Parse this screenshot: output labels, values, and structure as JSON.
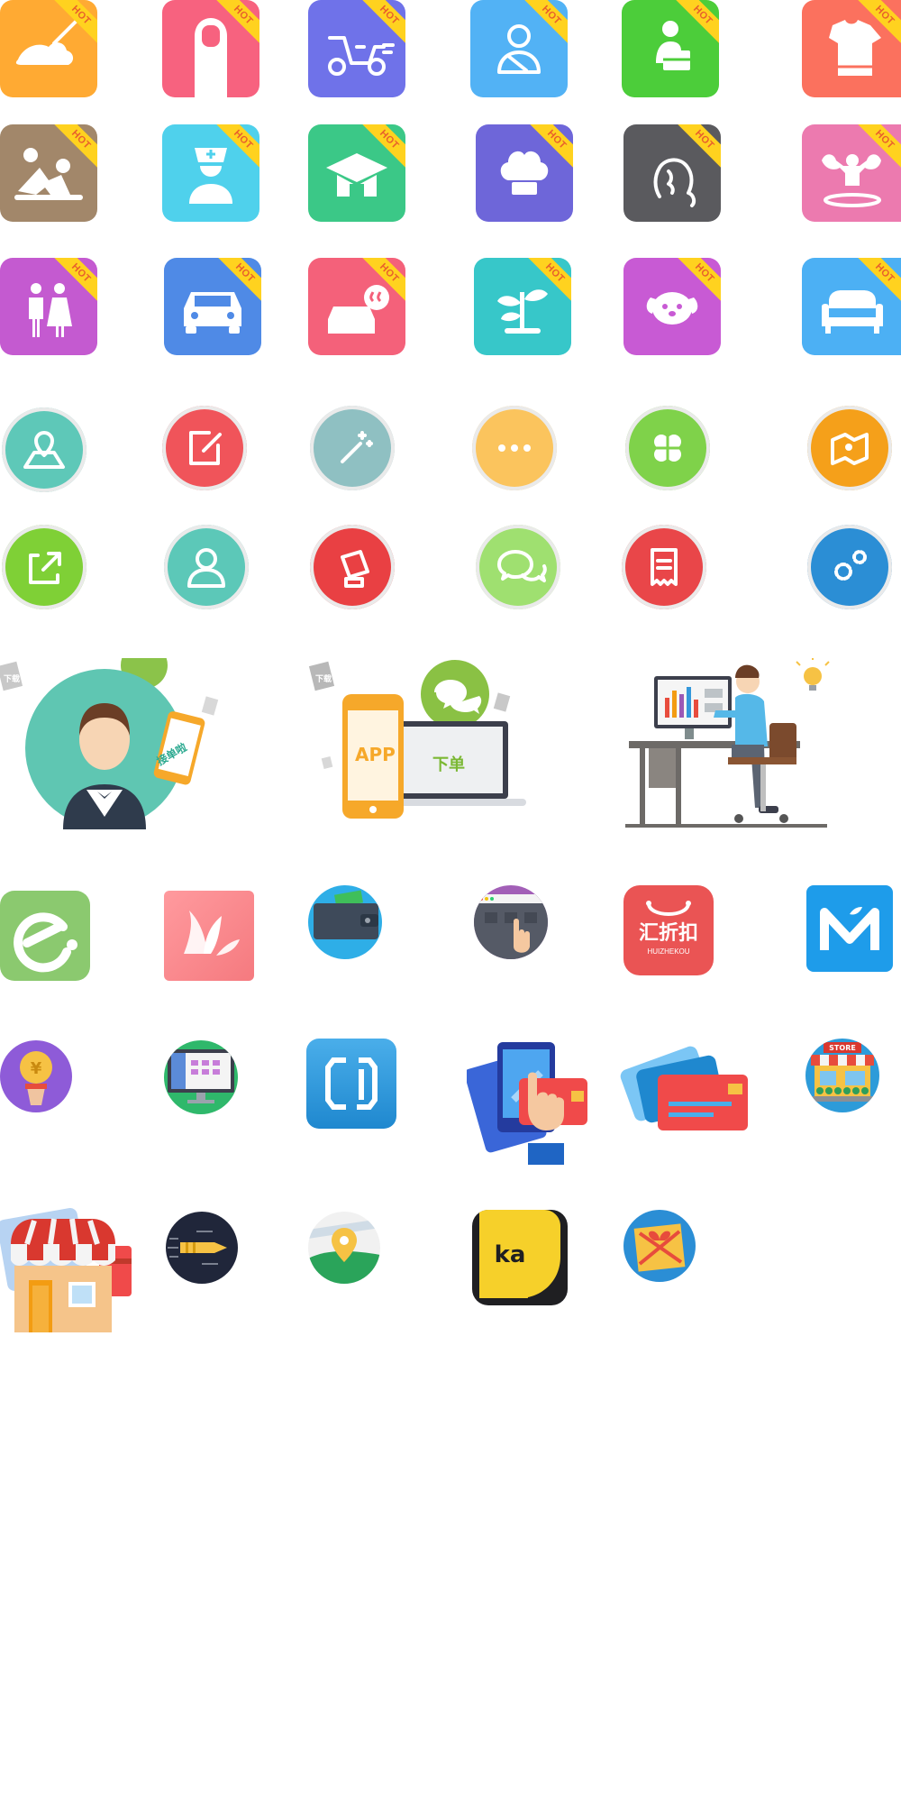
{
  "badge": {
    "hot": "HOT"
  },
  "hot_tiles": [
    {
      "name": "cleaning-service",
      "color": "#ffaa33"
    },
    {
      "name": "manicure",
      "color": "#f7627f"
    },
    {
      "name": "scooter-delivery",
      "color": "#6f72e9"
    },
    {
      "name": "driver",
      "color": "#52b2f5"
    },
    {
      "name": "courier",
      "color": "#4ccd3a"
    },
    {
      "name": "laundry",
      "color": "#fb715e"
    },
    {
      "name": "massage",
      "color": "#a2876a"
    },
    {
      "name": "nurse",
      "color": "#4fd1ec"
    },
    {
      "name": "education",
      "color": "#3bc887"
    },
    {
      "name": "chef",
      "color": "#6e66d9"
    },
    {
      "name": "hairdresser",
      "color": "#5a5a5e"
    },
    {
      "name": "fitness",
      "color": "#ec7aaf"
    },
    {
      "name": "wedding",
      "color": "#c45ad0"
    },
    {
      "name": "car-rental",
      "color": "#4f8ae6"
    },
    {
      "name": "car-wash",
      "color": "#f4617a"
    },
    {
      "name": "gardening",
      "color": "#37c7c9"
    },
    {
      "name": "pet-care",
      "color": "#c85ad4"
    },
    {
      "name": "furniture",
      "color": "#4cb0f4"
    }
  ],
  "round_icons": [
    {
      "name": "location-map",
      "color": "#5ec8b8"
    },
    {
      "name": "edit",
      "color": "#f0545a"
    },
    {
      "name": "magic-wand",
      "color": "#8fc0c2"
    },
    {
      "name": "more",
      "color": "#fbc45d"
    },
    {
      "name": "apps",
      "color": "#7fd24a"
    },
    {
      "name": "map",
      "color": "#f5a01a"
    },
    {
      "name": "share",
      "color": "#7fd036"
    },
    {
      "name": "user",
      "color": "#5cc8b8"
    },
    {
      "name": "report",
      "color": "#e94043"
    },
    {
      "name": "wechat",
      "color": "#9fe070"
    },
    {
      "name": "receipt",
      "color": "#e94649"
    },
    {
      "name": "settings",
      "color": "#2b8ed5"
    }
  ],
  "illustrations": {
    "waiter_badge": "接单啦",
    "order_app": "APP",
    "order_label": "下单",
    "download_tag": "下载"
  },
  "apps": {
    "huizhekou_cn": "汇折扣",
    "huizhekou_en": "HUIZHEKOU",
    "ka_label": "ka",
    "store_sign": "STORE",
    "yuan": "¥"
  }
}
